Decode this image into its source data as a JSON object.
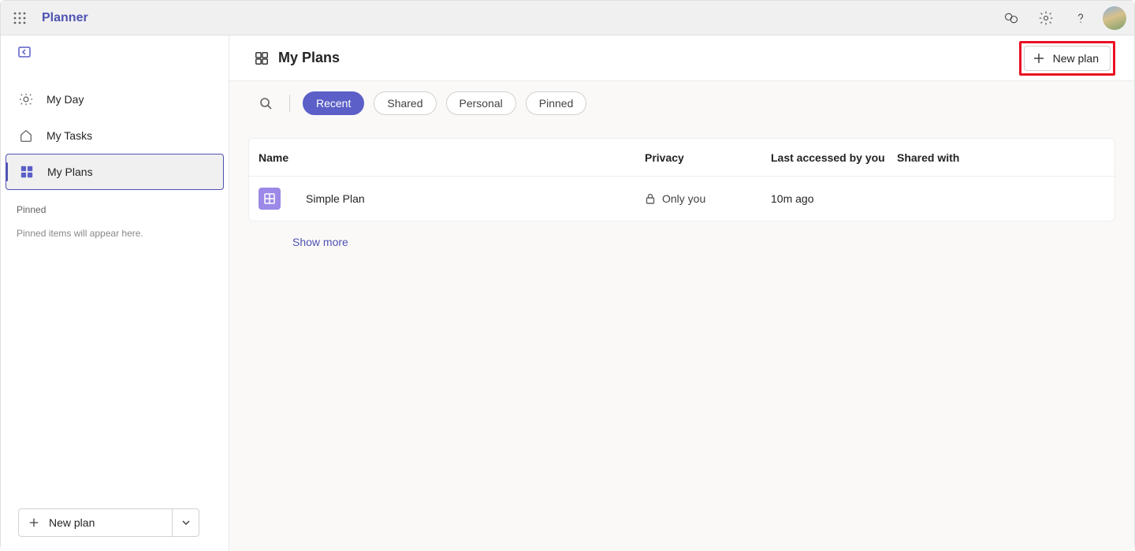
{
  "app": {
    "name": "Planner"
  },
  "sidebar": {
    "items": [
      {
        "label": "My Day"
      },
      {
        "label": "My Tasks"
      },
      {
        "label": "My Plans"
      }
    ],
    "pinned_header": "Pinned",
    "pinned_empty": "Pinned items will appear here.",
    "new_plan_label": "New plan"
  },
  "header": {
    "title": "My Plans",
    "new_plan_label": "New plan"
  },
  "filters": {
    "pills": [
      "Recent",
      "Shared",
      "Personal",
      "Pinned"
    ],
    "active_index": 0
  },
  "table": {
    "columns": {
      "name": "Name",
      "privacy": "Privacy",
      "last_accessed": "Last accessed by you",
      "shared_with": "Shared with"
    },
    "rows": [
      {
        "name": "Simple Plan",
        "privacy": "Only you",
        "last_accessed": "10m ago",
        "shared_with": ""
      }
    ],
    "show_more": "Show more"
  }
}
